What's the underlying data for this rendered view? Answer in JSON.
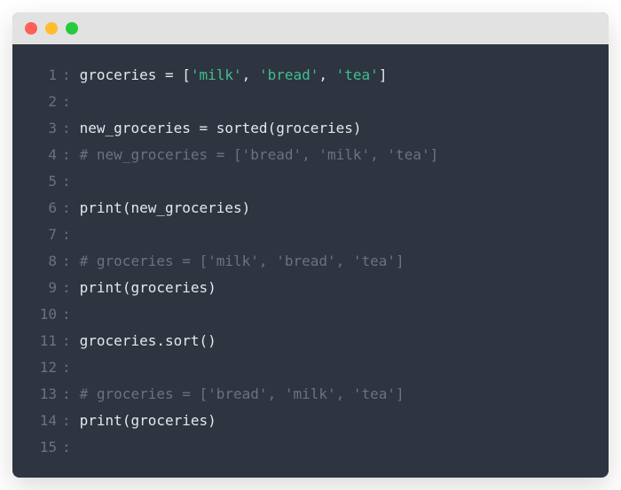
{
  "window": {
    "traffic_lights": [
      "red",
      "yellow",
      "green"
    ]
  },
  "code": {
    "lines": [
      {
        "n": "1",
        "tokens": [
          [
            "ident",
            "groceries "
          ],
          [
            "punct",
            "= ["
          ],
          [
            "string",
            "'milk'"
          ],
          [
            "punct",
            ", "
          ],
          [
            "string",
            "'bread'"
          ],
          [
            "punct",
            ", "
          ],
          [
            "string",
            "'tea'"
          ],
          [
            "punct",
            "]"
          ]
        ]
      },
      {
        "n": "2",
        "tokens": []
      },
      {
        "n": "3",
        "tokens": [
          [
            "ident",
            "new_groceries "
          ],
          [
            "punct",
            "= sorted(groceries)"
          ]
        ]
      },
      {
        "n": "4",
        "tokens": [
          [
            "comment",
            "# new_groceries = ['bread', 'milk', 'tea']"
          ]
        ]
      },
      {
        "n": "5",
        "tokens": []
      },
      {
        "n": "6",
        "tokens": [
          [
            "ident",
            "print"
          ],
          [
            "punct",
            "(new_groceries)"
          ]
        ]
      },
      {
        "n": "7",
        "tokens": []
      },
      {
        "n": "8",
        "tokens": [
          [
            "comment",
            "# groceries = ['milk', 'bread', 'tea']"
          ]
        ]
      },
      {
        "n": "9",
        "tokens": [
          [
            "ident",
            "print"
          ],
          [
            "punct",
            "(groceries)"
          ]
        ]
      },
      {
        "n": "10",
        "tokens": []
      },
      {
        "n": "11",
        "tokens": [
          [
            "ident",
            "groceries.sort"
          ],
          [
            "punct",
            "()"
          ]
        ]
      },
      {
        "n": "12",
        "tokens": []
      },
      {
        "n": "13",
        "tokens": [
          [
            "comment",
            "# groceries = ['bread', 'milk', 'tea']"
          ]
        ]
      },
      {
        "n": "14",
        "tokens": [
          [
            "ident",
            "print"
          ],
          [
            "punct",
            "(groceries)"
          ]
        ]
      },
      {
        "n": "15",
        "tokens": []
      }
    ],
    "colon": ":"
  }
}
